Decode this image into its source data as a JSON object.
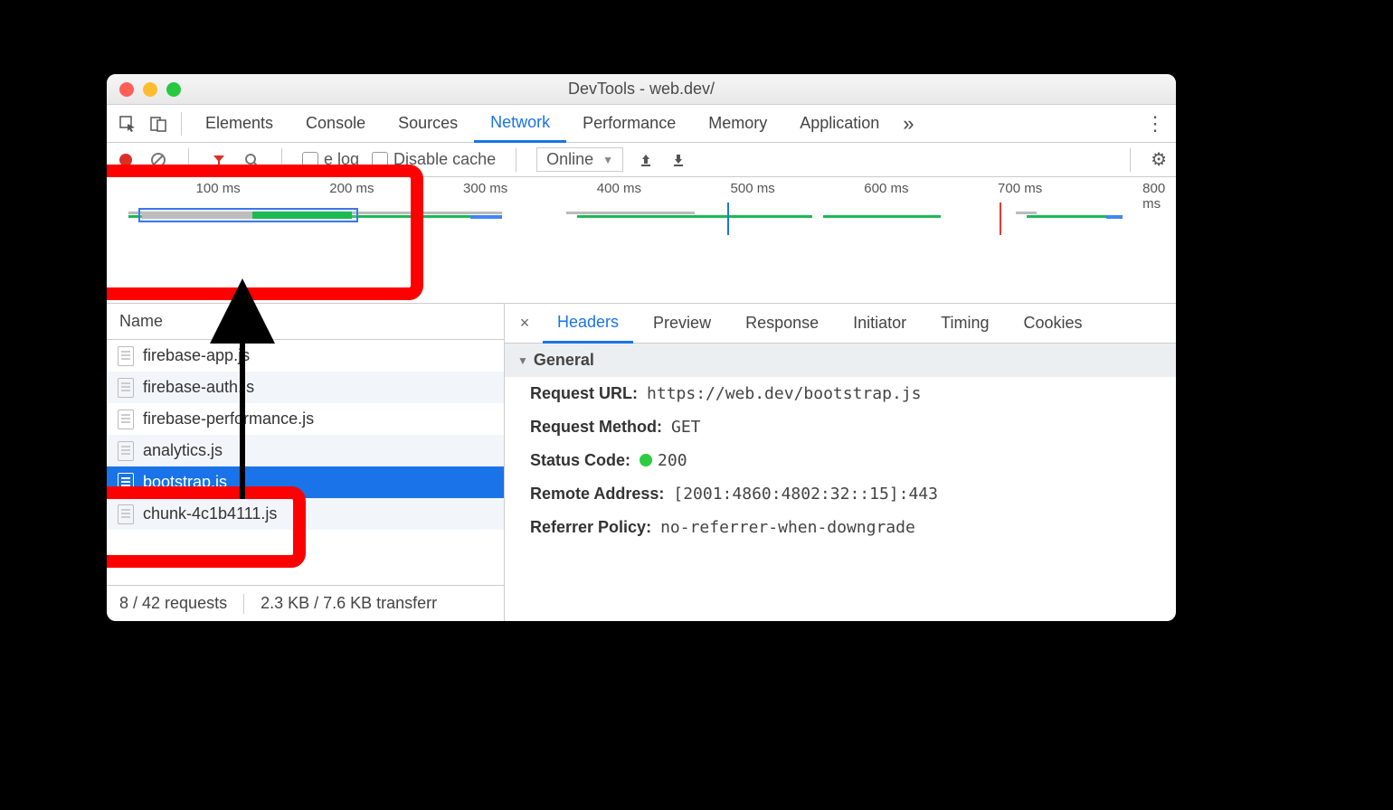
{
  "titlebar": {
    "title": "DevTools - web.dev/"
  },
  "tabs": {
    "items": [
      "Elements",
      "Console",
      "Sources",
      "Network",
      "Performance",
      "Memory",
      "Application"
    ],
    "active_index": 3
  },
  "toolbar": {
    "preserve_log_label": "e log",
    "disable_cache_label": "Disable cache",
    "throttle_value": "Online"
  },
  "overview": {
    "ticks": {
      "100": "100 ms",
      "200": "200 ms",
      "300": "300 ms",
      "400": "400 ms",
      "500": "500 ms",
      "600": "600 ms",
      "700": "700 ms",
      "800": "800 ms"
    }
  },
  "request_list": {
    "header": "Name",
    "items": [
      {
        "name": "firebase-app.js"
      },
      {
        "name": "firebase-auth.js"
      },
      {
        "name": "firebase-performance.js"
      },
      {
        "name": "analytics.js"
      },
      {
        "name": "bootstrap.js",
        "selected": true
      },
      {
        "name": "chunk-4c1b4111.js"
      }
    ],
    "status": {
      "requests": "8 / 42 requests",
      "transfer": "2.3 KB / 7.6 KB transferr"
    }
  },
  "detail": {
    "tabs": [
      "Headers",
      "Preview",
      "Response",
      "Initiator",
      "Timing",
      "Cookies"
    ],
    "active_index": 0,
    "section_title": "General",
    "request_url_label": "Request URL:",
    "request_url": "https://web.dev/bootstrap.js",
    "request_method_label": "Request Method:",
    "request_method": "GET",
    "status_code_label": "Status Code:",
    "status_code": "200",
    "remote_address_label": "Remote Address:",
    "remote_address": "[2001:4860:4802:32::15]:443",
    "referrer_policy_label": "Referrer Policy:",
    "referrer_policy": "no-referrer-when-downgrade"
  }
}
